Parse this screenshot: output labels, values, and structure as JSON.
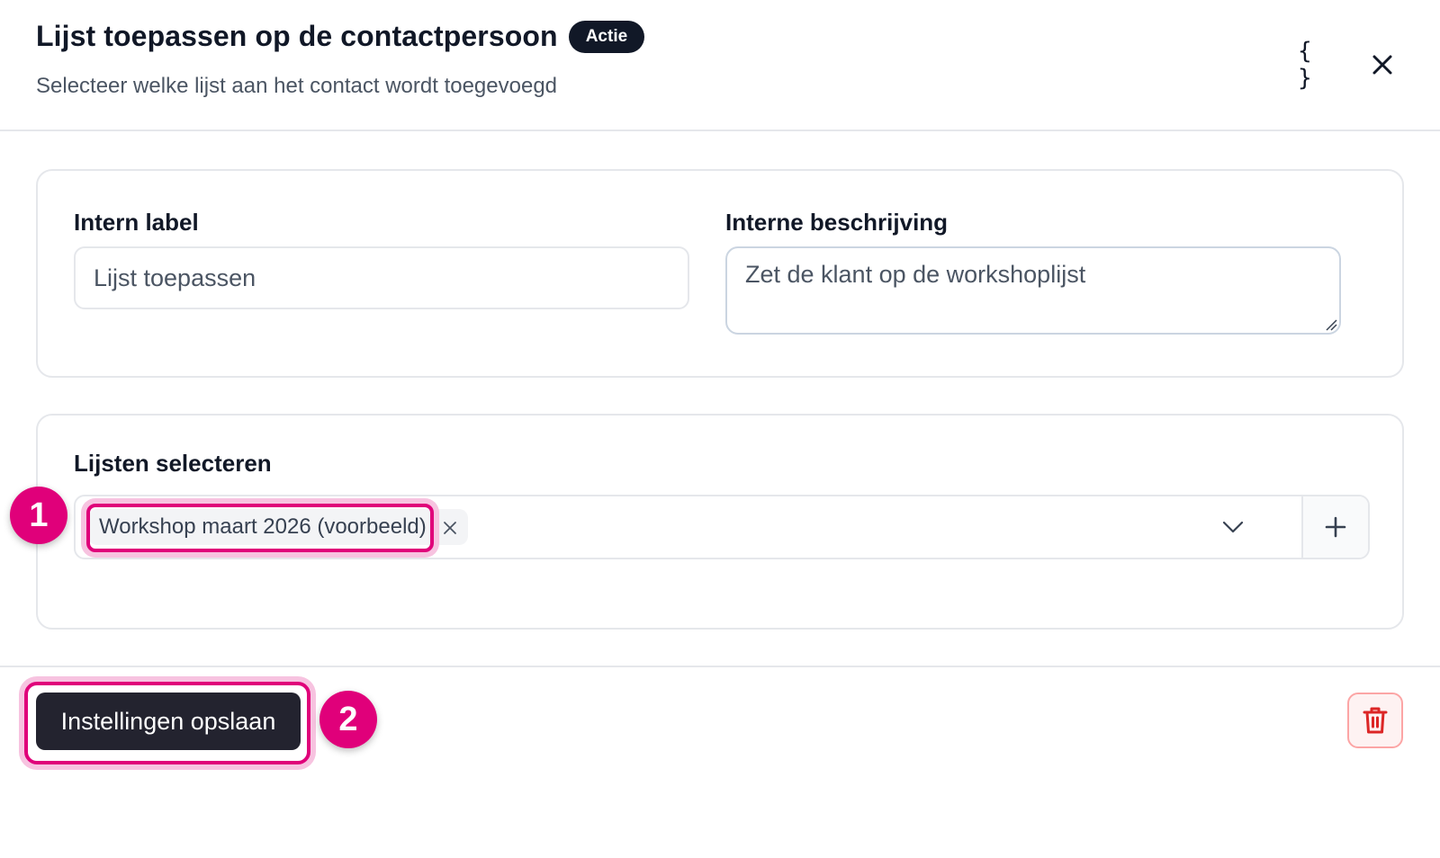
{
  "header": {
    "title": "Lijst toepassen op de contactpersoon",
    "badge": "Actie",
    "subtitle": "Selecteer welke lijst aan het contact wordt toegevoegd",
    "braces_icon_glyph": "{ }",
    "icons": [
      "braces-icon",
      "close-icon"
    ]
  },
  "general": {
    "label_title": "Intern label",
    "label_value": "Lijst toepassen",
    "description_title": "Interne beschrijving",
    "description_value": "Zet de klant op de workshoplijst"
  },
  "lists": {
    "title": "Lijsten selecteren",
    "selected": [
      {
        "label": "Workshop maart 2026 (voorbeeld)"
      }
    ],
    "icons": [
      "remove-chip-icon",
      "chevron-down-icon",
      "plus-icon"
    ]
  },
  "footer": {
    "save_label": "Instellingen opslaan",
    "delete_icon": "trash-icon"
  },
  "callouts": [
    "1",
    "2"
  ],
  "colors": {
    "accent": "#e0007a",
    "accent_glow": "#f7c3e0",
    "primary_button": "#23232f",
    "danger": "#dc2626",
    "badge_bg": "#111827"
  }
}
